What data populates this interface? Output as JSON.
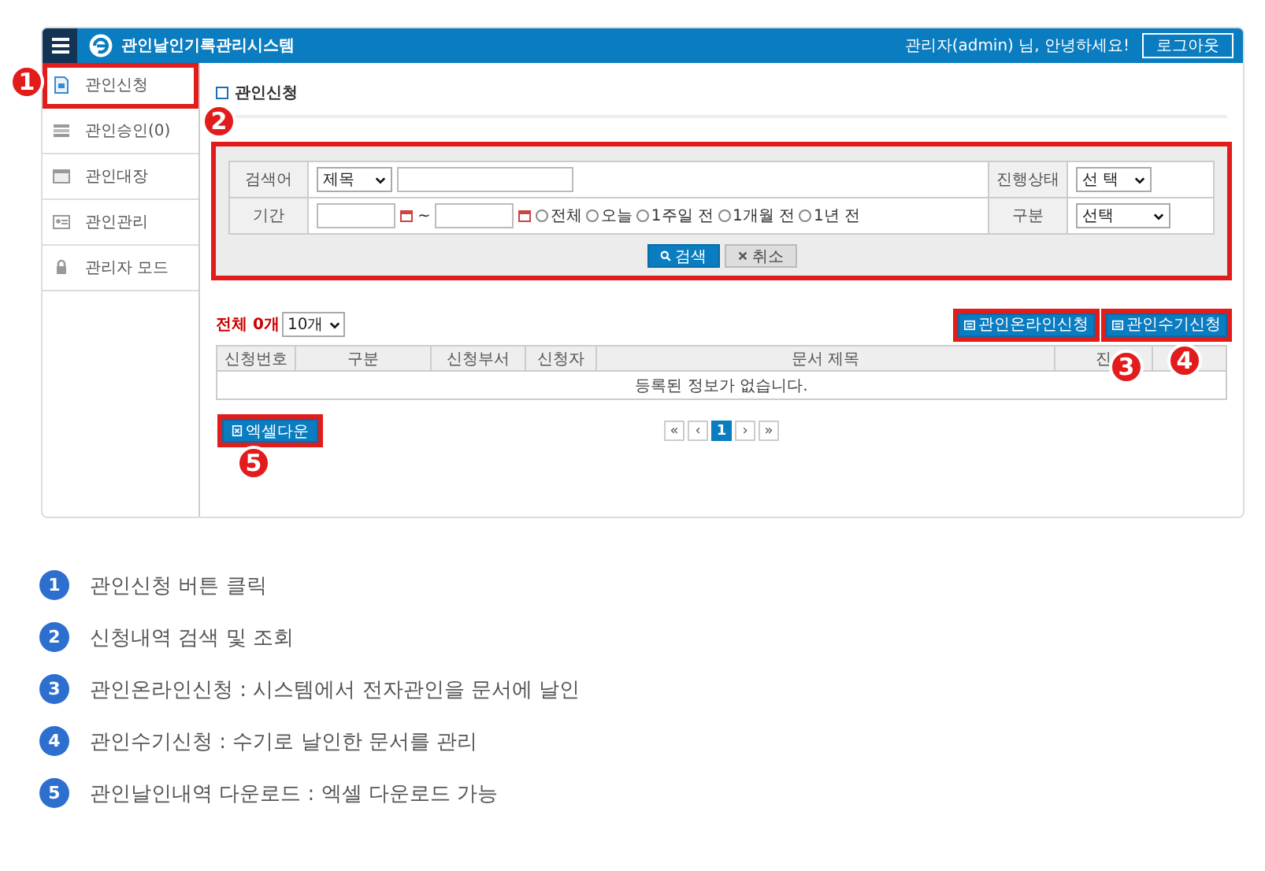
{
  "header": {
    "title": "관인날인기록관리시스템",
    "greeting": "관리자(admin) 님, 안녕하세요!",
    "logout": "로그아웃"
  },
  "sidebar": [
    {
      "label": "관인신청",
      "kind": "document",
      "highlighted": true
    },
    {
      "label": "관인승인(0)",
      "kind": "list",
      "highlighted": false
    },
    {
      "label": "관인대장",
      "kind": "ledger",
      "highlighted": false
    },
    {
      "label": "관인관리",
      "kind": "card",
      "highlighted": false
    },
    {
      "label": "관리자 모드",
      "kind": "lock",
      "highlighted": false
    }
  ],
  "page_title": "관인신청",
  "search": {
    "highlighted": true,
    "keyword_label": "검색어",
    "keyword_field": "제목",
    "status_label": "진행상태",
    "status_value": "선 택",
    "period_label": "기간",
    "period_separator": "~",
    "period_options": [
      {
        "label": "전체",
        "selected": false
      },
      {
        "label": "오늘",
        "selected": false
      },
      {
        "label": "1주일 전",
        "selected": false
      },
      {
        "label": "1개월 전",
        "selected": false
      },
      {
        "label": "1년 전",
        "selected": false
      }
    ],
    "type_label": "구분",
    "type_value": "선택",
    "search_button": "검색",
    "cancel_button": "취소"
  },
  "list": {
    "total": "전체 0개",
    "page_size": "10개",
    "actions": [
      {
        "label": "관인온라인신청",
        "highlighted": true
      },
      {
        "label": "관인수기신청",
        "highlighted": true
      }
    ],
    "columns": [
      "신청번호",
      "구분",
      "신청부서",
      "신청자",
      "문서 제목",
      "진",
      ""
    ],
    "empty_message": "등록된 정보가 없습니다.",
    "excel_button": {
      "label": "엑셀다운",
      "highlighted": true
    },
    "pagination": [
      {
        "label": "«",
        "selected": false
      },
      {
        "label": "‹",
        "selected": false
      },
      {
        "label": "1",
        "selected": true
      },
      {
        "label": "›",
        "selected": false
      },
      {
        "label": "»",
        "selected": false
      }
    ]
  },
  "callouts": [
    "1",
    "2",
    "3",
    "4",
    "5"
  ],
  "legend": [
    {
      "number": "1",
      "text": "관인신청 버튼 클릭"
    },
    {
      "number": "2",
      "text": "신청내역 검색 및 조회"
    },
    {
      "number": "3",
      "text": "관인온라인신청 : 시스템에서 전자관인을 문서에 날인"
    },
    {
      "number": "4",
      "text": "관인수기신청 : 수기로 날인한 문서를 관리"
    },
    {
      "number": "5",
      "text": "관인날인내역 다운로드 : 엑셀 다운로드 가능"
    }
  ]
}
